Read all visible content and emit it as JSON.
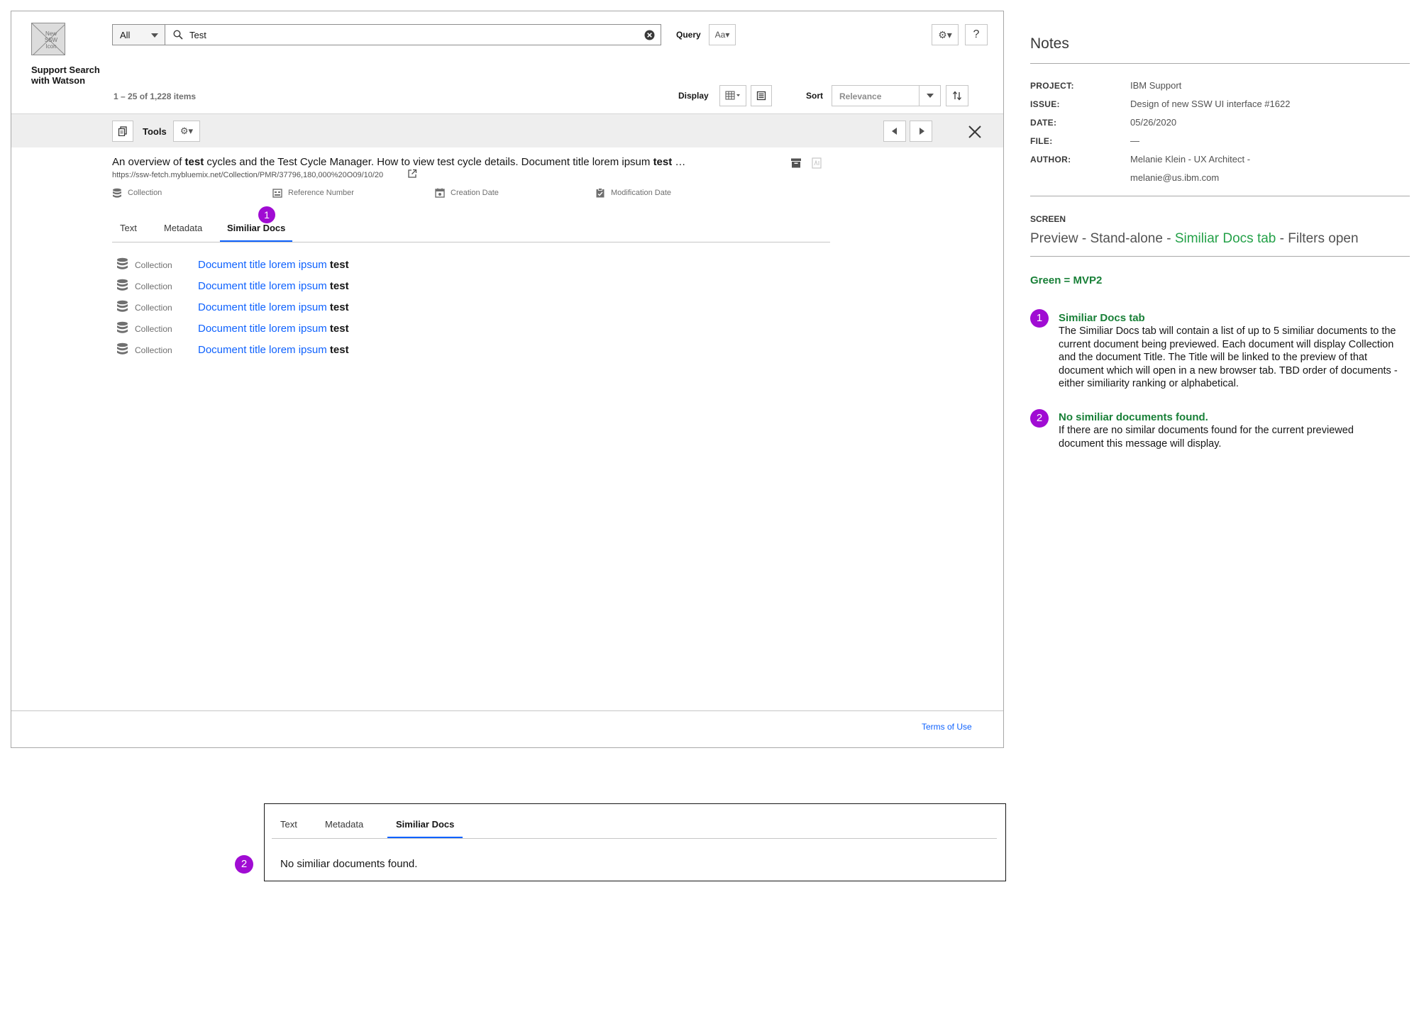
{
  "app": {
    "logo_text": "New SSW Icon",
    "name": "Support Search with Watson"
  },
  "search": {
    "scope": "All",
    "value": "Test",
    "query_label": "Query",
    "query_btn": "Aa▾"
  },
  "results": {
    "count": "1 – 25 of 1,228 items",
    "display_label": "Display",
    "sort_label": "Sort",
    "sort_value": "Relevance"
  },
  "toolbar": {
    "tools_label": "Tools",
    "settings_glyph": "⚙▾"
  },
  "preview": {
    "title_parts": [
      "An overview of ",
      "test",
      " cycles and the Test Cycle Manager. How to view test cycle details. Document title lorem ipsum ",
      "test",
      " …"
    ],
    "url": "https://ssw-fetch.mybluemix.net/Collection/PMR/37796,180,000%20O09/10/20",
    "meta": {
      "collection": "Collection",
      "reference": "Reference Number",
      "created": "Creation Date",
      "modified": "Modification Date"
    },
    "tabs": {
      "text": "Text",
      "metadata": "Metadata",
      "similar": "Similiar Docs"
    },
    "similar_docs": [
      {
        "collection": "Collection",
        "title": "Document title lorem ipsum ",
        "highlight": "test"
      },
      {
        "collection": "Collection",
        "title": "Document title lorem ipsum ",
        "highlight": "test"
      },
      {
        "collection": "Collection",
        "title": "Document title lorem ipsum ",
        "highlight": "test"
      },
      {
        "collection": "Collection",
        "title": "Document title lorem ipsum ",
        "highlight": "test"
      },
      {
        "collection": "Collection",
        "title": "Document title lorem ipsum ",
        "highlight": "test"
      }
    ]
  },
  "footer": {
    "terms": "Terms of Use"
  },
  "notes": {
    "title": "Notes",
    "project_key": "PROJECT:",
    "project": "IBM Support",
    "issue_key": "ISSUE:",
    "issue": "Design of new SSW UI interface #1622",
    "date_key": "DATE:",
    "date": "05/26/2020",
    "file_key": "FILE:",
    "file": "—",
    "author_key": "AUTHOR:",
    "author": "Melanie Klein - UX Architect -",
    "author_email": "melanie@us.ibm.com",
    "screen_key": "SCREEN",
    "screen_a": "Preview - Stand-alone - ",
    "screen_green": "Similiar Docs tab",
    "screen_b": " - Filters open",
    "legend": "Green = MVP2",
    "note1_num": "1",
    "note1_head": "Similiar Docs tab",
    "note1_body": "The Similiar Docs tab will contain a list of up to 5 similiar documents to the current document being previewed. Each document will display Collection and the document Title. The Title will be linked to the preview of that document which will open in a new browser tab. TBD order of documents - either similiarity ranking or alphabetical.",
    "note2_num": "2",
    "note2_head": "No similiar documents found.",
    "note2_body": "If there are no similar documents found for the current previewed document this message will display."
  },
  "empty_state": {
    "tabs": {
      "text": "Text",
      "metadata": "Metadata",
      "similar": "Similiar Docs"
    },
    "message": "No similiar documents found."
  },
  "colors": {
    "link": "#0f62fe",
    "badge": "#a00cd3",
    "mvp2_green": "#198038",
    "tab_underline": "#0f62fe"
  }
}
